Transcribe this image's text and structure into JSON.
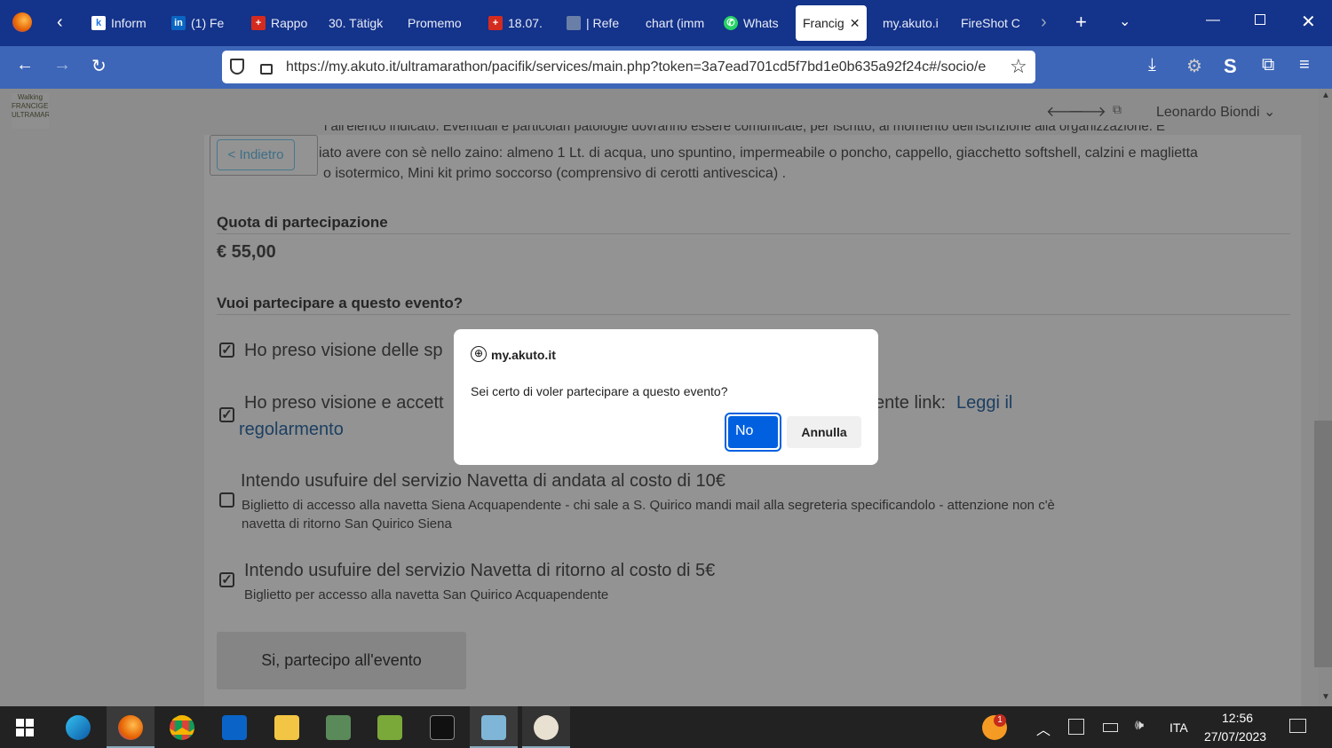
{
  "browser": {
    "tabs": [
      {
        "label": "Inform",
        "icon": "k-icon"
      },
      {
        "label": "(1) Fe",
        "icon": "linkedin-icon"
      },
      {
        "label": "Rappo",
        "icon": "swiss-icon"
      },
      {
        "label": "30. Tätigk",
        "icon": ""
      },
      {
        "label": "Promemo",
        "icon": ""
      },
      {
        "label": "18.07.",
        "icon": "swiss-icon"
      },
      {
        "label": "| Refe",
        "icon": "onys-icon"
      },
      {
        "label": "chart (imm",
        "icon": ""
      },
      {
        "label": "Whats",
        "icon": "whatsapp-icon"
      },
      {
        "label": "Francig",
        "icon": "",
        "active": true
      },
      {
        "label": "my.akuto.i",
        "icon": ""
      },
      {
        "label": "FireShot C",
        "icon": ""
      }
    ],
    "url": "https://my.akuto.it/ultramarathon/pacifik/services/main.php?token=3a7ead701cd5f7bd1e0b635a92f24c#/socio/e"
  },
  "header": {
    "user": "Leonardo Biondi",
    "logo_text": "Walking Francigena Ultramarathon"
  },
  "content": {
    "back_label": "< Indietro",
    "line1": "i all'elenco indicato. Eventuali e particolari patologie dovranno essere comunicate, per iscritto, al momento dell'iscrizione alla organizzazione. E",
    "line2": "iato avere con sè nello zaino: almeno 1 Lt. di acqua, uno spuntino, impermeabile o poncho, cappello, giacchetto softshell, calzini e maglietta",
    "line3": "o isotermico, Mini kit primo soccorso (comprensivo di cerotti antivescica) .",
    "quota_title": "Quota di partecipazione",
    "quota_value": "€ 55,00",
    "question": "Vuoi partecipare a questo evento?",
    "opt1": "Ho preso visione delle sp",
    "opt2a": "Ho preso visione e accett",
    "opt2b": "ente link:",
    "opt2_link1": "Leggi il",
    "opt2_link2": "regolarmento",
    "opt3_title": "Intendo usufuire del servizio Navetta di andata al costo di 10€",
    "opt3_desc1": "Biglietto di accesso alla navetta Siena Acquapendente - chi sale a S. Quirico mandi mail alla segreteria specificandolo - attenzione non c'è",
    "opt3_desc2": "navetta di ritorno San Quirico Siena",
    "opt4_title": "Intendo usufuire del servizio Navetta di ritorno al costo di 5€",
    "opt4_desc": "Biglietto per accesso alla navetta San Quirico Acquapendente",
    "submit": "Si, partecipo all'evento",
    "checked": [
      true,
      true,
      false,
      true
    ]
  },
  "dialog": {
    "origin": "my.akuto.it",
    "message": "Sei certo di voler partecipare a questo evento?",
    "ok": "No",
    "cancel": "Annulla",
    "accent": "#0060df"
  },
  "taskbar": {
    "time": "12:56",
    "date": "27/07/2023",
    "lang": "ITA",
    "weather_badge": "1"
  }
}
